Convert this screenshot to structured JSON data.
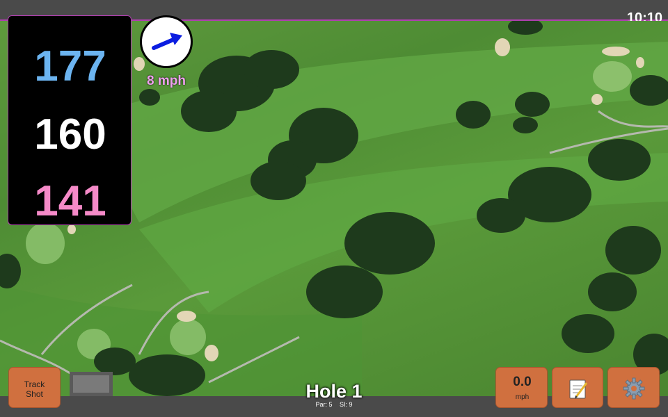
{
  "status_bar": {
    "time": "10:10"
  },
  "distances": {
    "back": "177",
    "middle": "160",
    "front": "141"
  },
  "wind": {
    "speed": "8 mph"
  },
  "hole": {
    "title": "Hole 1",
    "par": "Par: 5",
    "si": "SI: 9"
  },
  "buttons": {
    "track_shot_line1": "Track",
    "track_shot_line2": "Shot",
    "speed_value": "0.0",
    "speed_unit": "mph",
    "notes_icon": "notepad-icon",
    "settings_icon": "gear-icon"
  },
  "colors": {
    "back": "#6cb4f0",
    "middle": "#ffffff",
    "front": "#f58ac8",
    "button": "#d0703f",
    "wind_text": "#f0a0f0"
  }
}
